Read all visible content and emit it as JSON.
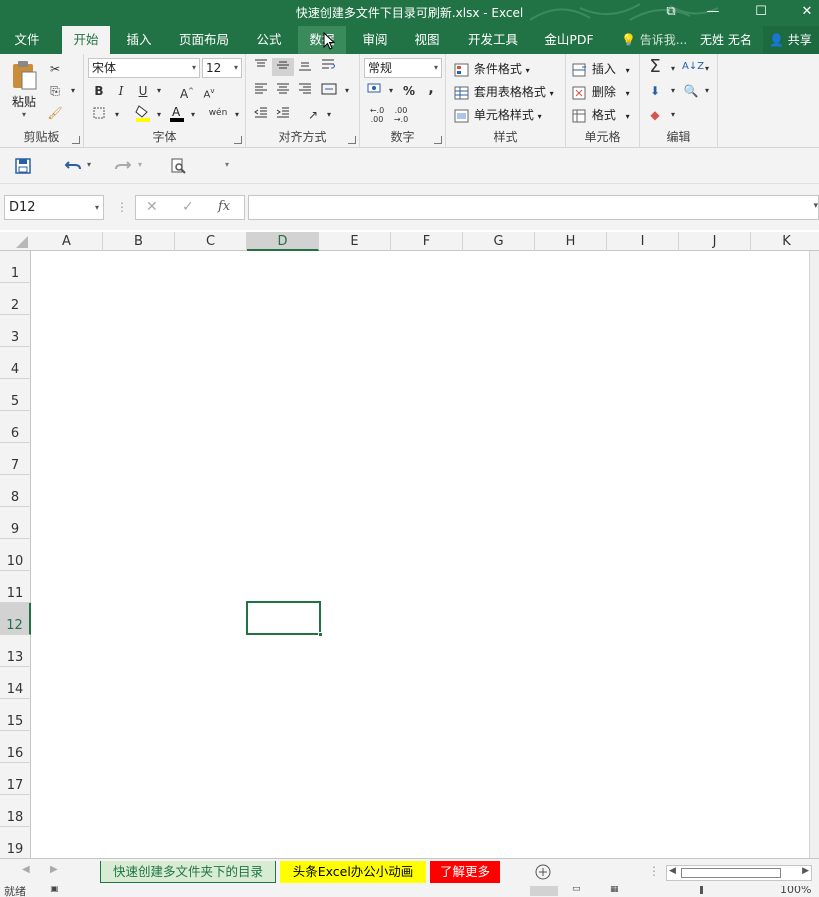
{
  "window": {
    "title": "快速创建多文件下目录可刷新.xlsx - Excel",
    "restore_glyph": "⧉",
    "minimize_glyph": "—",
    "maximize_glyph": "☐",
    "close_glyph": "✕"
  },
  "tabs": [
    {
      "label": "文件"
    },
    {
      "label": "开始"
    },
    {
      "label": "插入"
    },
    {
      "label": "页面布局"
    },
    {
      "label": "公式"
    },
    {
      "label": "数据"
    },
    {
      "label": "审阅"
    },
    {
      "label": "视图"
    },
    {
      "label": "开发工具"
    },
    {
      "label": "金山PDF"
    }
  ],
  "tell_me": "告诉我...",
  "user": "无姓 无名",
  "share": "共享",
  "ribbon": {
    "clipboard": {
      "paste": "粘贴",
      "label": "剪贴板"
    },
    "font": {
      "name": "宋体",
      "size": "12",
      "bold": "B",
      "italic": "I",
      "underline": "U",
      "label": "字体",
      "phonetic": "wén"
    },
    "alignment": {
      "label": "对齐方式"
    },
    "number": {
      "format": "常规",
      "percent": "%",
      "comma": ",",
      "label": "数字"
    },
    "styles": {
      "conditional": "条件格式",
      "table": "套用表格格式",
      "cell": "单元格样式",
      "label": "样式"
    },
    "cells": {
      "insert": "插入",
      "delete": "删除",
      "format": "格式",
      "label": "单元格"
    },
    "editing": {
      "label": "编辑"
    }
  },
  "formula_bar": {
    "name_box": "D12",
    "cancel": "✕",
    "enter": "✓",
    "fx": "fx",
    "value": ""
  },
  "columns": [
    "A",
    "B",
    "C",
    "D",
    "E",
    "F",
    "G",
    "H",
    "I",
    "J",
    "K"
  ],
  "rows": [
    "1",
    "2",
    "3",
    "4",
    "5",
    "6",
    "7",
    "8",
    "9",
    "10",
    "11",
    "12",
    "13",
    "14",
    "15",
    "16",
    "17",
    "18",
    "19"
  ],
  "selected_cell": {
    "column": "D",
    "row": "12"
  },
  "sheets": [
    {
      "label": "快速创建多文件夹下的目录",
      "bg": "#d7ecd3",
      "color": "#217346"
    },
    {
      "label": "头条Excel办公小动画",
      "bg": "#ffff00",
      "color": "#000000"
    },
    {
      "label": "了解更多",
      "bg": "#ff0000",
      "color": "#ffffff"
    }
  ],
  "status": {
    "ready": "就绪",
    "zoom": "100%"
  },
  "colors": {
    "accent": "#217346",
    "ribbon_bg": "#f3f3f3"
  }
}
